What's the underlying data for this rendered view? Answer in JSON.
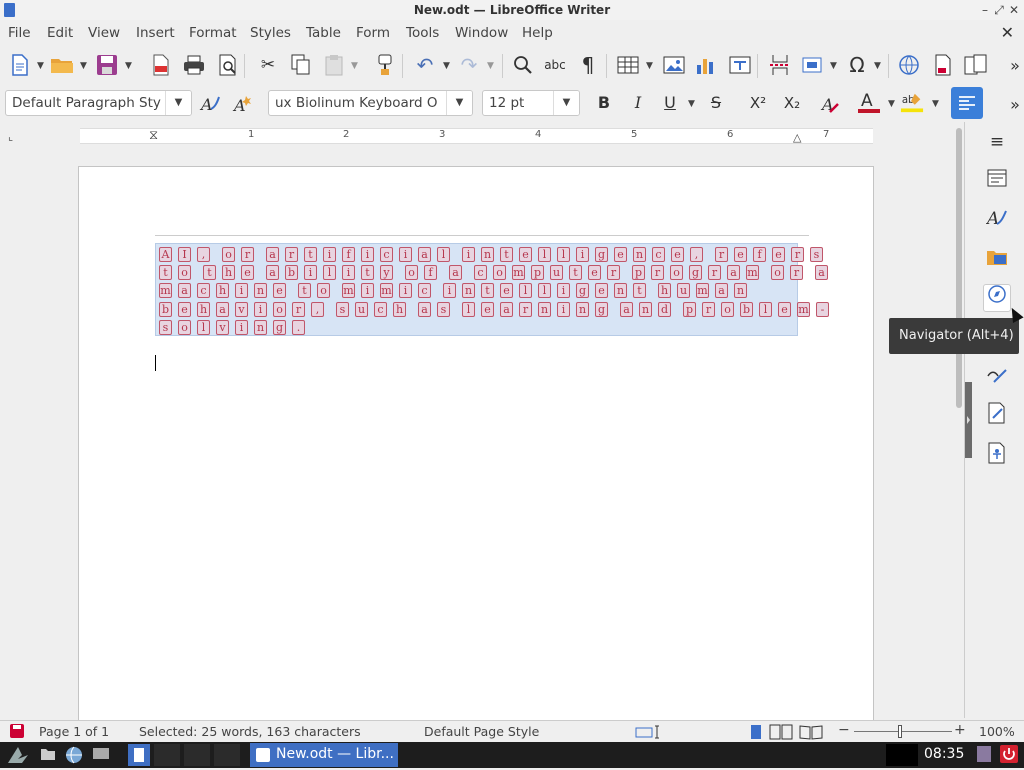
{
  "window": {
    "title": "New.odt — LibreOffice Writer",
    "minimize_icon": "minimize-icon",
    "restore_icon": "restore-icon",
    "close_icon": "close-icon"
  },
  "menu": [
    "File",
    "Edit",
    "View",
    "Insert",
    "Format",
    "Styles",
    "Table",
    "Form",
    "Tools",
    "Window",
    "Help"
  ],
  "toolbar_format": {
    "paragraph_style": "Default Paragraph Sty",
    "font_name": "ux Biolinum Keyboard O",
    "font_size": "12 pt",
    "bold_label": "B",
    "italic_label": "I",
    "underline_label": "U",
    "strike_label": "S",
    "superscript_label": "X²",
    "subscript_label": "X₂"
  },
  "ruler": {
    "numbers": [
      "1",
      "2",
      "3",
      "4",
      "5",
      "6",
      "7"
    ]
  },
  "document": {
    "lines": [
      "AI, or artificial intelligence, refers",
      "to the ability of a computer program or a",
      "machine to mimic intelligent human",
      "behavior, such as learning and problem-",
      "solving."
    ]
  },
  "tooltip": "Navigator (Alt+4)",
  "statusbar": {
    "page": "Page 1 of 1",
    "selection": "Selected: 25 words, 163 characters",
    "page_style": "Default Page Style",
    "zoom": "100%"
  },
  "taskbar": {
    "task_label": "New.odt — Libr...",
    "clock": "08:35"
  },
  "colors": {
    "selection_bg": "#d7e4f5",
    "keyboard_glyph": "#b5364d",
    "accent": "#3f6fc3"
  }
}
